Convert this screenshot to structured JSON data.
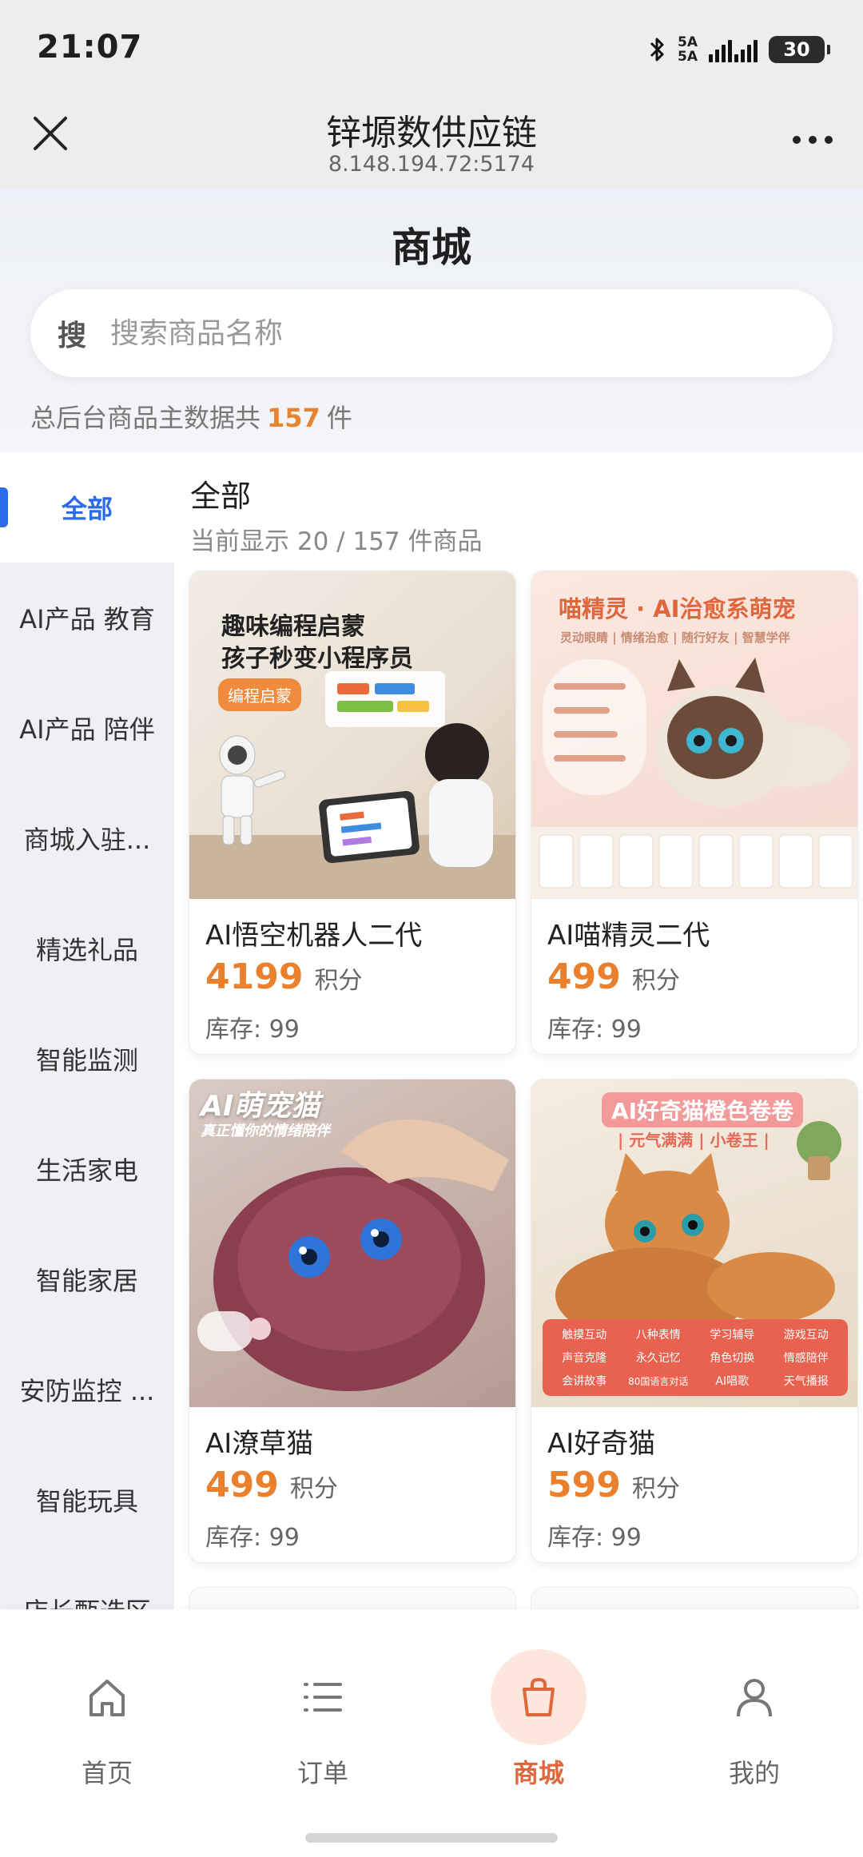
{
  "status_bar": {
    "time": "21:07",
    "network_label_top": "5A",
    "network_label_bottom": "5A",
    "battery": "30",
    "icons": [
      "bluetooth-icon",
      "signal-icon",
      "battery-icon"
    ]
  },
  "title_bar": {
    "title": "锌塬数供应链",
    "subtitle": "8.148.194.72:5174"
  },
  "page": {
    "title": "商城",
    "search_icon_label": "搜",
    "search_placeholder": "搜索商品名称",
    "summary_prefix": "总后台商品主数据共",
    "summary_count": "157",
    "summary_suffix": "件"
  },
  "sidebar": {
    "items": [
      {
        "label": "全部",
        "active": true
      },
      {
        "label": "AI产品 教育"
      },
      {
        "label": "AI产品 陪伴"
      },
      {
        "label": "商城入驻..."
      },
      {
        "label": "精选礼品"
      },
      {
        "label": "智能监测"
      },
      {
        "label": "生活家电"
      },
      {
        "label": "智能家居"
      },
      {
        "label": "安防监控 ..."
      },
      {
        "label": "智能玩具"
      },
      {
        "label": "店长甄选区"
      }
    ]
  },
  "main": {
    "category_title": "全部",
    "showing_text": "当前显示 20 / 157 件商品",
    "points_unit": "积分",
    "products": [
      {
        "name": "AI悟空机器人二代",
        "price": "4199",
        "stock": "库存: 99",
        "image_texts": {
          "line1": "趣味编程启蒙",
          "line2": "孩子秒变小程序员",
          "chip": "编程启蒙"
        }
      },
      {
        "name": "AI喵精灵二代",
        "price": "499",
        "stock": "库存: 99",
        "image_texts": {
          "line1": "喵精灵 · AI治愈系萌宠",
          "line2": "灵动眼睛 | 情绪治愈 | 随行好友 | 智慧学伴"
        }
      },
      {
        "name": "AI潦草猫",
        "price": "499",
        "stock": "库存: 99",
        "image_texts": {
          "line1": "AI萌宠猫",
          "line2": "真正懂你的情绪陪伴"
        }
      },
      {
        "name": "AI好奇猫",
        "price": "599",
        "stock": "库存: 99",
        "image_texts": {
          "line1": "AI好奇猫橙色卷卷",
          "line2": "| 元气满满 | 小卷王 |",
          "features": [
            "触摸互动",
            "八种表情",
            "学习辅导",
            "游戏互动",
            "声音克隆",
            "永久记忆",
            "角色切换",
            "情感陪伴",
            "会讲故事",
            "80国语言对话",
            "AI唱歌",
            "天气播报"
          ]
        }
      }
    ]
  },
  "tabbar": {
    "tabs": [
      {
        "label": "首页",
        "icon": "home-icon"
      },
      {
        "label": "订单",
        "icon": "list-icon"
      },
      {
        "label": "商城",
        "icon": "shopping-bag-icon",
        "active": true
      },
      {
        "label": "我的",
        "icon": "user-icon"
      }
    ]
  },
  "colors": {
    "accent_blue": "#2d6ae8",
    "price_orange": "#ea7f2c",
    "tab_active": "#e0663c"
  }
}
